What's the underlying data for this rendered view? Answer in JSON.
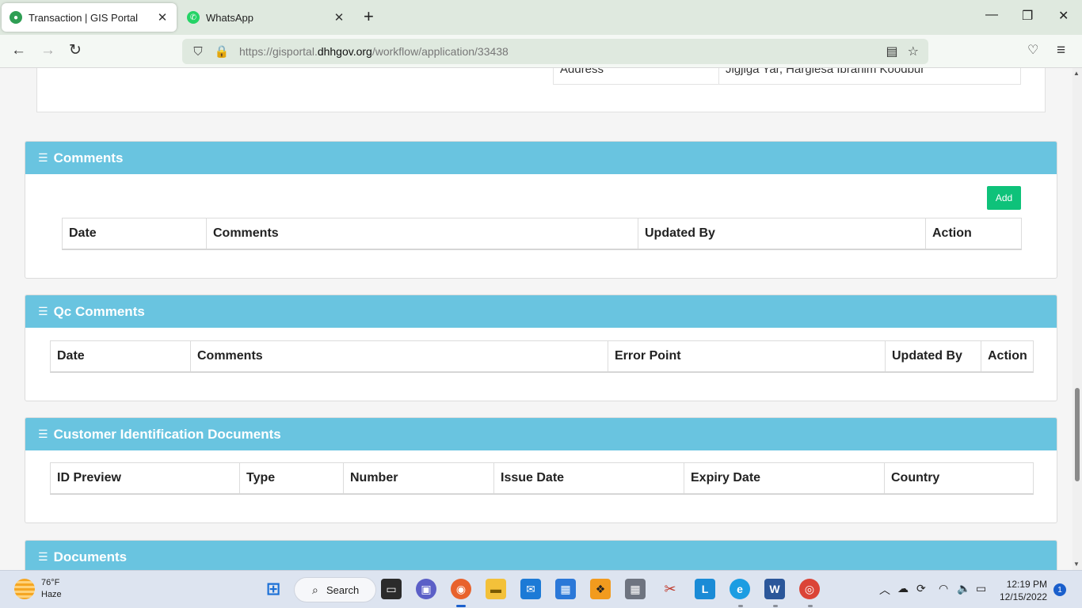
{
  "browser": {
    "tabs": [
      {
        "label": "Transaction | GIS Portal",
        "active": true
      },
      {
        "label": "WhatsApp",
        "active": false
      }
    ],
    "url_prefix": "https://gisportal.",
    "url_domain": "dhhgov.org",
    "url_path": "/workflow/application/33438"
  },
  "prev_section": {
    "address_key": "Address",
    "address_value": "Jigjiga Yar, Hargiesa Ibrahim Koodbur"
  },
  "comments": {
    "title": "Comments",
    "add_label": "Add",
    "columns": [
      "Date",
      "Comments",
      "Updated By",
      "Action"
    ]
  },
  "qc_comments": {
    "title": "Qc Comments",
    "columns": [
      "Date",
      "Comments",
      "Error Point",
      "Updated By",
      "Action"
    ]
  },
  "customer_docs": {
    "title": "Customer Identification Documents",
    "columns": [
      "ID Preview",
      "Type",
      "Number",
      "Issue Date",
      "Expiry Date",
      "Country"
    ]
  },
  "documents": {
    "title": "Documents"
  },
  "taskbar": {
    "temperature": "76°F",
    "condition": "Haze",
    "search_label": "Search",
    "time": "12:19 PM",
    "date": "12/15/2022",
    "notification_count": "1"
  },
  "colors": {
    "panel_header": "#69c4e0",
    "add_button": "#0ec27a",
    "tab_bar": "#dfe9df"
  }
}
